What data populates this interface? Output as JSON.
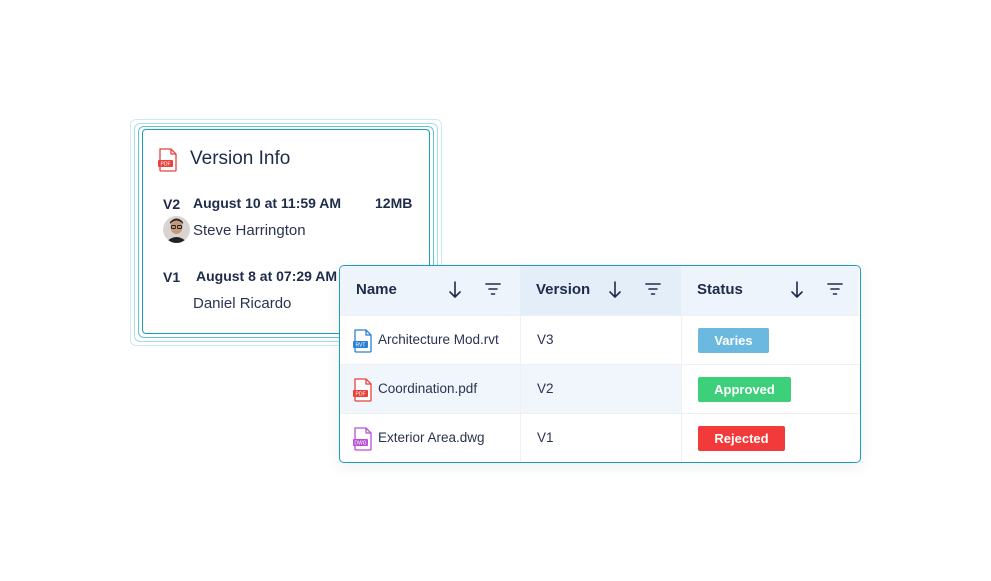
{
  "version_info": {
    "title": "Version Info",
    "title_icon": "pdf-file-icon",
    "versions": [
      {
        "tag": "V2",
        "date": "August 10 at 11:59 AM",
        "size": "12MB",
        "user": "Steve Harrington"
      },
      {
        "tag": "V1",
        "date": "August 8 at 07:29 AM",
        "size": "",
        "user": "Daniel Ricardo"
      }
    ]
  },
  "table": {
    "columns": [
      {
        "label": "Name"
      },
      {
        "label": "Version"
      },
      {
        "label": "Status"
      }
    ],
    "rows": [
      {
        "icon_type": "RVT",
        "name": "Architecture Mod.rvt",
        "version": "V3",
        "status": "Varies",
        "status_color": "#6bb8e0"
      },
      {
        "icon_type": "PDF",
        "name": "Coordination.pdf",
        "version": "V2",
        "status": "Approved",
        "status_color": "#3ecf7a"
      },
      {
        "icon_type": "DWG",
        "name": "Exterior Area.dwg",
        "version": "V1",
        "status": "Rejected",
        "status_color": "#f23a3a"
      }
    ]
  },
  "colors": {
    "accent_border": "#1a9dc0",
    "pdf_icon": "#e8413a",
    "rvt_icon": "#2b7fd6",
    "dwg_icon": "#b84fd6"
  }
}
